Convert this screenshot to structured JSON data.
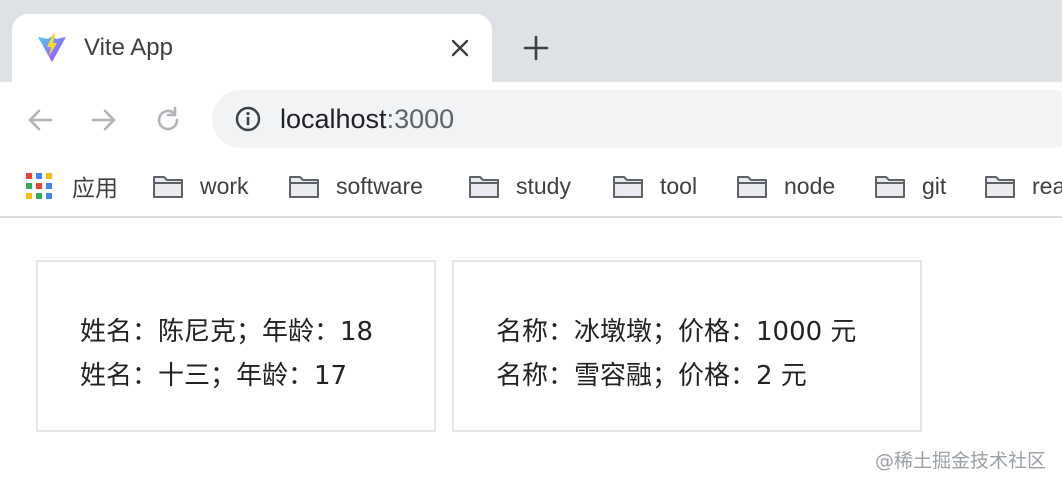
{
  "tab": {
    "title": "Vite App",
    "close_glyph": "✕",
    "favicon": "vite-logo"
  },
  "newtab": {
    "glyph": "+"
  },
  "toolbar": {
    "back_icon": "arrow-left-icon",
    "forward_icon": "arrow-right-icon",
    "reload_icon": "reload-icon",
    "url_host": "localhost",
    "url_port": ":3000"
  },
  "bookmarks": {
    "apps_label": "应用",
    "folders": [
      "work",
      "software",
      "study",
      "tool",
      "node",
      "git",
      "rea"
    ]
  },
  "people": [
    {
      "text": "姓名：陈尼克；年龄：18"
    },
    {
      "text": "姓名：十三；年龄：17"
    }
  ],
  "products": [
    {
      "text": "名称：冰墩墩；价格：1000 元"
    },
    {
      "text": "名称：雪容融；价格：2 元"
    }
  ],
  "watermark": "@稀土掘金技术社区",
  "colors": {
    "tabstrip_bg": "#dee1e6",
    "omnibox_bg": "#f1f3f4",
    "vite_purple": "#8f63ff",
    "vite_yellow": "#ffd62e"
  }
}
